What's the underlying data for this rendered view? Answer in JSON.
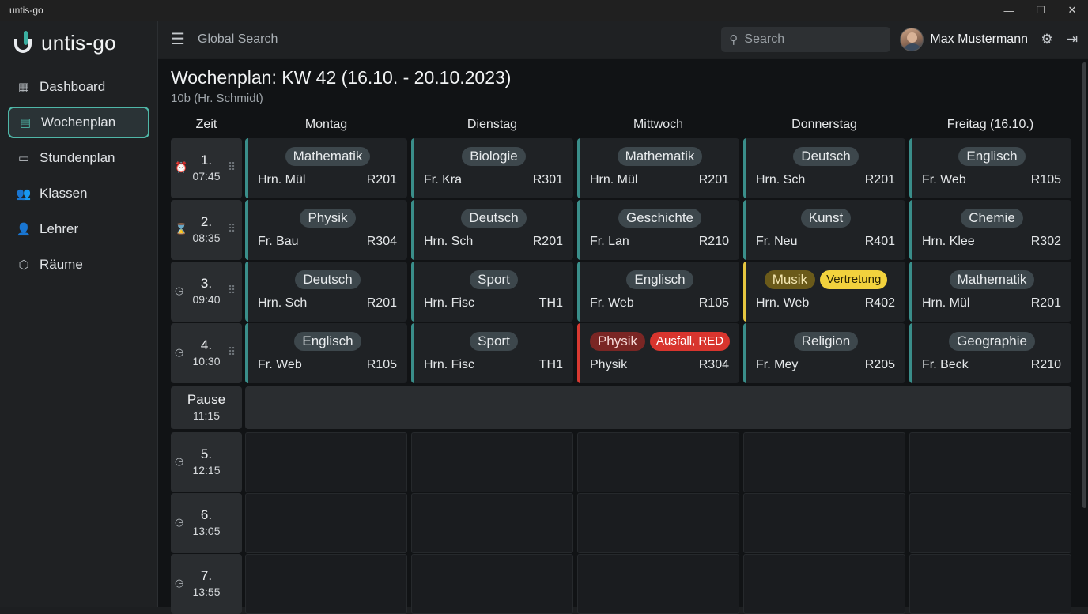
{
  "window": {
    "title": "untis-go",
    "controls": [
      "—",
      "☐",
      "✕"
    ]
  },
  "brand": {
    "name": "untis-go"
  },
  "sidebar": {
    "items": [
      {
        "label": "Dashboard",
        "icon": "dashboard-icon",
        "glyph": "▦",
        "active": false
      },
      {
        "label": "Wochenplan",
        "icon": "calendar-icon",
        "glyph": "▤",
        "active": true
      },
      {
        "label": "Stundenplan",
        "icon": "calendar-blank-icon",
        "glyph": "▭",
        "active": false
      },
      {
        "label": "Klassen",
        "icon": "group-icon",
        "glyph": "👥",
        "active": false
      },
      {
        "label": "Lehrer",
        "icon": "teacher-icon",
        "glyph": "👤",
        "active": false
      },
      {
        "label": "Räume",
        "icon": "room-icon",
        "glyph": "⬡",
        "active": false
      }
    ]
  },
  "header": {
    "global_search": "Global Search",
    "search_placeholder": "Search",
    "user_name": "Max Mustermann"
  },
  "page": {
    "title": "Wochenplan: KW 42 (16.10. - 20.10.2023)",
    "subtitle": "10b (Hr. Schmidt)"
  },
  "columns": [
    "Zeit",
    "Montag",
    "Dienstag",
    "Mittwoch",
    "Donnerstag",
    "Freitag (16.10.)"
  ],
  "periods": [
    {
      "num": "1.",
      "time": "07:45",
      "icon": "alarm-icon",
      "glyph": "⏰"
    },
    {
      "num": "2.",
      "time": "08:35",
      "icon": "hourglass-icon",
      "glyph": "⌛"
    },
    {
      "num": "3.",
      "time": "09:40",
      "icon": "clock-icon",
      "glyph": "◷"
    },
    {
      "num": "4.",
      "time": "10:30",
      "icon": "clock-icon",
      "glyph": "◷"
    }
  ],
  "pause": {
    "label": "Pause",
    "time": "11:15"
  },
  "later_periods": [
    {
      "num": "5.",
      "time": "12:15",
      "icon": "clock-icon",
      "glyph": "◷"
    },
    {
      "num": "6.",
      "time": "13:05",
      "icon": "clock-icon",
      "glyph": "◷"
    },
    {
      "num": "7.",
      "time": "13:55",
      "icon": "clock-icon",
      "glyph": "◷"
    }
  ],
  "lessons": [
    [
      {
        "subject": "Mathematik",
        "teacher": "Hrn. Mül",
        "room": "R201",
        "status": "normal"
      },
      {
        "subject": "Biologie",
        "teacher": "Fr. Kra",
        "room": "R301",
        "status": "normal"
      },
      {
        "subject": "Mathematik",
        "teacher": "Hrn. Mül",
        "room": "R201",
        "status": "normal"
      },
      {
        "subject": "Deutsch",
        "teacher": "Hrn. Sch",
        "room": "R201",
        "status": "normal"
      },
      {
        "subject": "Englisch",
        "teacher": "Fr. Web",
        "room": "R105",
        "status": "normal"
      }
    ],
    [
      {
        "subject": "Physik",
        "teacher": "Fr. Bau",
        "room": "R304",
        "status": "normal"
      },
      {
        "subject": "Deutsch",
        "teacher": "Hrn. Sch",
        "room": "R201",
        "status": "normal"
      },
      {
        "subject": "Geschichte",
        "teacher": "Fr. Lan",
        "room": "R210",
        "status": "normal"
      },
      {
        "subject": "Kunst",
        "teacher": "Fr. Neu",
        "room": "R401",
        "status": "normal"
      },
      {
        "subject": "Chemie",
        "teacher": "Hrn. Klee",
        "room": "R302",
        "status": "normal"
      }
    ],
    [
      {
        "subject": "Deutsch",
        "teacher": "Hrn. Sch",
        "room": "R201",
        "status": "normal"
      },
      {
        "subject": "Sport",
        "teacher": "Hrn. Fisc",
        "room": "TH1",
        "status": "normal"
      },
      {
        "subject": "Englisch",
        "teacher": "Fr. Web",
        "room": "R105",
        "status": "normal"
      },
      {
        "subject": "Musik",
        "badge": "Vertretung",
        "teacher": "Hrn. Web",
        "room": "R402",
        "status": "substitution"
      },
      {
        "subject": "Mathematik",
        "teacher": "Hrn. Mül",
        "room": "R201",
        "status": "normal"
      }
    ],
    [
      {
        "subject": "Englisch",
        "teacher": "Fr. Web",
        "room": "R105",
        "status": "normal"
      },
      {
        "subject": "Sport",
        "teacher": "Hrn. Fisc",
        "room": "TH1",
        "status": "normal"
      },
      {
        "subject": "Physik",
        "badge": "Ausfall, RED",
        "teacher": "Physik",
        "room": "R304",
        "status": "cancelled"
      },
      {
        "subject": "Religion",
        "teacher": "Fr. Mey",
        "room": "R205",
        "status": "normal"
      },
      {
        "subject": "Geographie",
        "teacher": "Fr. Beck",
        "room": "R210",
        "status": "normal"
      }
    ]
  ],
  "colors": {
    "accent": "#4fb7a8",
    "lesson_border": "#3a8e8a",
    "substitution": "#f2d23d",
    "cancelled": "#d8352e"
  }
}
